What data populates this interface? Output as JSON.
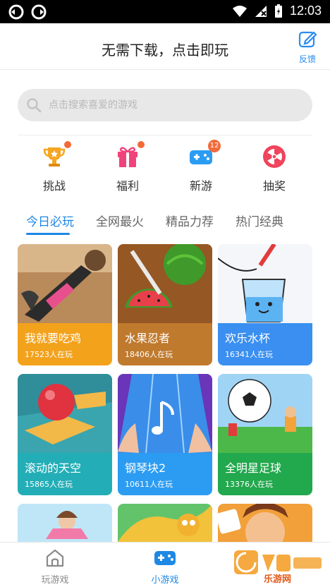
{
  "status_bar": {
    "time": "12:03"
  },
  "header": {
    "title": "无需下载，点击即玩",
    "feedback_label": "反馈"
  },
  "search": {
    "placeholder": "点击搜索喜爱的游戏"
  },
  "categories": [
    {
      "label": "挑战",
      "icon": "trophy-icon",
      "badge": "dot"
    },
    {
      "label": "福利",
      "icon": "gift-icon",
      "badge": "dot"
    },
    {
      "label": "新游",
      "icon": "gamepad-icon",
      "badge": "12"
    },
    {
      "label": "抽奖",
      "icon": "prize-wheel-icon",
      "badge": ""
    }
  ],
  "tabs": [
    {
      "label": "今日必玩",
      "active": true
    },
    {
      "label": "全网最火",
      "active": false
    },
    {
      "label": "精品力荐",
      "active": false
    },
    {
      "label": "热门经典",
      "active": false
    }
  ],
  "games": [
    {
      "name": "我就要吃鸡",
      "players": "17523人在玩",
      "color": "#f3a21c"
    },
    {
      "name": "水果忍者",
      "players": "18406人在玩",
      "color": "#c07a2e"
    },
    {
      "name": "欢乐水杯",
      "players": "16341人在玩",
      "color": "#3a8ff0"
    },
    {
      "name": "滚动的天空",
      "players": "15865人在玩",
      "color": "#23aeb7"
    },
    {
      "name": "钢琴块2",
      "players": "10611人在玩",
      "color": "#2b9cf2"
    },
    {
      "name": "全明星足球",
      "players": "13376人在玩",
      "color": "#22a84d"
    }
  ],
  "bottom_nav": [
    {
      "label": "玩游戏",
      "icon": "home-icon",
      "active": false
    },
    {
      "label": "小游戏",
      "icon": "gamepad-icon",
      "active": true
    }
  ],
  "watermark": {
    "text": "乐游网"
  },
  "colors": {
    "accent": "#1e88e5",
    "badge": "#f26a3a"
  }
}
